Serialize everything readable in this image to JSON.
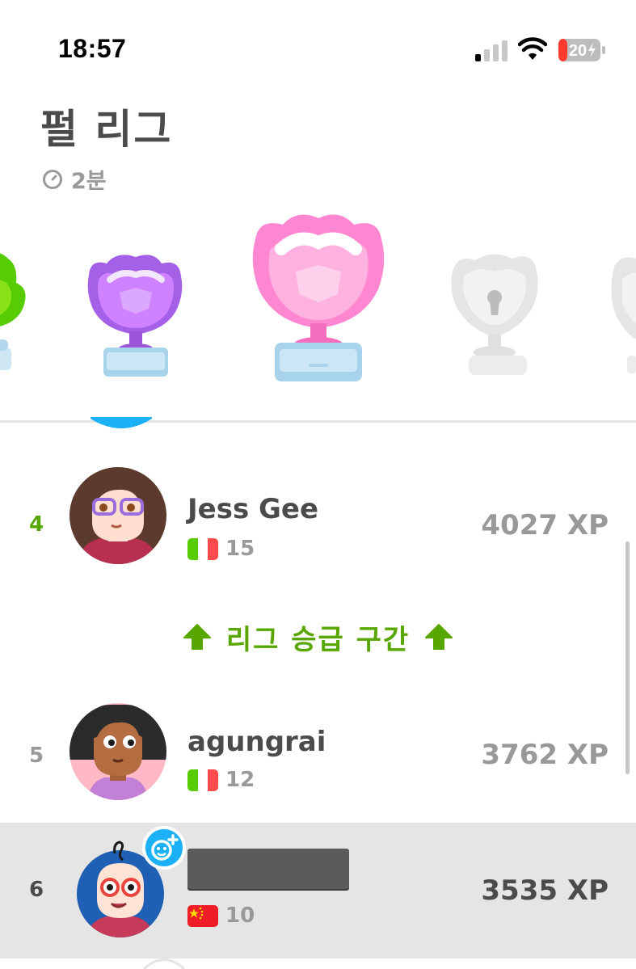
{
  "status_bar": {
    "time": "18:57",
    "battery_level": "20"
  },
  "league": {
    "title": "펄 리그",
    "time_left": "2분"
  },
  "trophies": [
    {
      "name": "emerald-trophy",
      "color": "#58cc02",
      "state": "partial-left"
    },
    {
      "name": "amethyst-trophy",
      "color": "#ce82ff",
      "state": "unlocked"
    },
    {
      "name": "pearl-trophy",
      "color": "#ff86d0",
      "state": "current"
    },
    {
      "name": "obsidian-trophy",
      "color": "#e5e5e5",
      "state": "locked"
    },
    {
      "name": "diamond-trophy",
      "color": "#e5e5e5",
      "state": "partial-right"
    }
  ],
  "promotion_zone_label": "리그 승급 구간",
  "leaderboard": [
    {
      "rank": "4",
      "username": "Jess Gee",
      "flag": "italy",
      "streak": "15",
      "xp": "4027 XP",
      "rank_color": "#58a700",
      "current": false
    },
    {
      "rank": "5",
      "username": "agungrai",
      "flag": "italy",
      "streak": "12",
      "xp": "3762 XP",
      "rank_color": "#999999",
      "current": false
    },
    {
      "rank": "6",
      "username": "",
      "flag": "china",
      "streak": "10",
      "xp": "3535 XP",
      "rank_color": "#4b4b4b",
      "current": true
    }
  ],
  "colors": {
    "promotion_green": "#58a700",
    "muted_gray": "#999999",
    "highlight_row": "#e5e5e5"
  }
}
